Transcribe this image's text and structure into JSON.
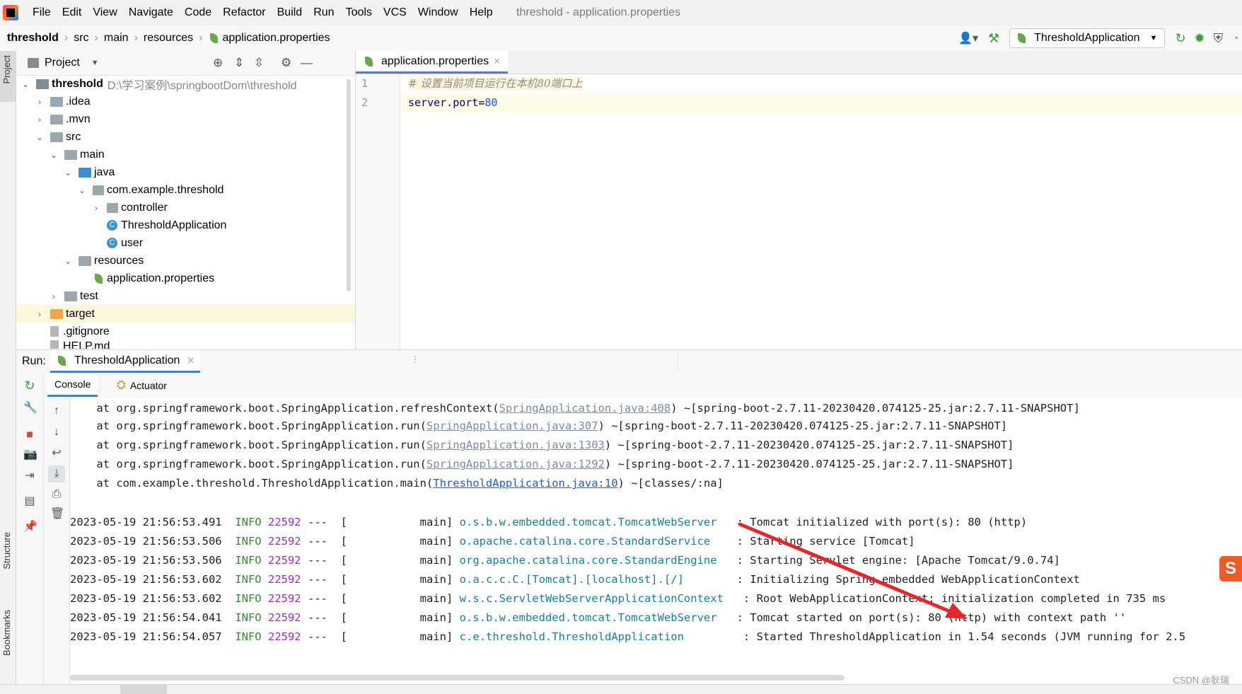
{
  "menubar": {
    "items": [
      "File",
      "Edit",
      "View",
      "Navigate",
      "Code",
      "Refactor",
      "Build",
      "Run",
      "Tools",
      "VCS",
      "Window",
      "Help"
    ],
    "title": "threshold - application.properties"
  },
  "navbar": {
    "crumbs": [
      "threshold",
      "src",
      "main",
      "resources",
      "application.properties"
    ],
    "run_config": "ThresholdApplication"
  },
  "left_stripe": {
    "project": "Project",
    "structure": "Structure",
    "bookmarks": "Bookmarks"
  },
  "project_panel": {
    "title": "Project",
    "root_name": "threshold",
    "root_path": "D:\\学习案例\\springbootDom\\threshold",
    "items": [
      {
        "label": ".idea"
      },
      {
        "label": ".mvn"
      },
      {
        "label": "src"
      },
      {
        "label": "main"
      },
      {
        "label": "java"
      },
      {
        "label": "com.example.threshold"
      },
      {
        "label": "controller"
      },
      {
        "label": "ThresholdApplication"
      },
      {
        "label": "user"
      },
      {
        "label": "resources"
      },
      {
        "label": "application.properties"
      },
      {
        "label": "test"
      },
      {
        "label": "target"
      },
      {
        "label": ".gitignore"
      },
      {
        "label": "HELP.md"
      }
    ]
  },
  "editor": {
    "tab": "application.properties",
    "line_numbers": [
      "1",
      "2"
    ],
    "line1": "# 设置当前项目运行在本机80端口上",
    "line2_key": "server.port",
    "line2_eq": "=",
    "line2_val": "80"
  },
  "run": {
    "label": "Run:",
    "tab": "ThresholdApplication",
    "subtabs": [
      "Console",
      "Actuator"
    ]
  },
  "console": {
    "stack": [
      {
        "pre": "    at org.springframework.boot.SpringApplication.refreshContext(",
        "link": "SpringApplication.java:408",
        "post": ") ~[spring-boot-2.7.11-20230420.074125-25.jar:2.7.11-SNAPSHOT]"
      },
      {
        "pre": "    at org.springframework.boot.SpringApplication.run(",
        "link": "SpringApplication.java:307",
        "post": ") ~[spring-boot-2.7.11-20230420.074125-25.jar:2.7.11-SNAPSHOT]"
      },
      {
        "pre": "    at org.springframework.boot.SpringApplication.run(",
        "link": "SpringApplication.java:1303",
        "post": ") ~[spring-boot-2.7.11-20230420.074125-25.jar:2.7.11-SNAPSHOT]"
      },
      {
        "pre": "    at org.springframework.boot.SpringApplication.run(",
        "link": "SpringApplication.java:1292",
        "post": ") ~[spring-boot-2.7.11-20230420.074125-25.jar:2.7.11-SNAPSHOT]"
      },
      {
        "pre": "    at com.example.threshold.ThresholdApplication.main(",
        "link": "ThresholdApplication.java:10",
        "post": ") ~[classes/:na]"
      }
    ],
    "logs": [
      {
        "ts": "2023-05-19 21:56:53.491",
        "level": "INFO",
        "pid": "22592",
        "thread": "---  [           main]",
        "logger": "o.s.b.w.embedded.tomcat.TomcatWebServer ",
        "msg": "  : Tomcat initialized with port(s): 80 (http)"
      },
      {
        "ts": "2023-05-19 21:56:53.506",
        "level": "INFO",
        "pid": "22592",
        "thread": "---  [           main]",
        "logger": "o.apache.catalina.core.StandardService  ",
        "msg": "  : Starting service [Tomcat]"
      },
      {
        "ts": "2023-05-19 21:56:53.506",
        "level": "INFO",
        "pid": "22592",
        "thread": "---  [           main]",
        "logger": "org.apache.catalina.core.StandardEngine ",
        "msg": "  : Starting Servlet engine: [Apache Tomcat/9.0.74]"
      },
      {
        "ts": "2023-05-19 21:56:53.602",
        "level": "INFO",
        "pid": "22592",
        "thread": "---  [           main]",
        "logger": "o.a.c.c.C.[Tomcat].[localhost].[/]      ",
        "msg": "  : Initializing Spring embedded WebApplicationContext"
      },
      {
        "ts": "2023-05-19 21:56:53.602",
        "level": "INFO",
        "pid": "22592",
        "thread": "---  [           main]",
        "logger": "w.s.c.ServletWebServerApplicationContext ",
        "msg": "  : Root WebApplicationContext: initialization completed in 735 ms"
      },
      {
        "ts": "2023-05-19 21:56:54.041",
        "level": "INFO",
        "pid": "22592",
        "thread": "---  [           main]",
        "logger": "o.s.b.w.embedded.tomcat.TomcatWebServer ",
        "msg": "  : Tomcat started on port(s): 80 (http) with context path ''"
      },
      {
        "ts": "2023-05-19 21:56:54.057",
        "level": "INFO",
        "pid": "22592",
        "thread": "---  [           main]",
        "logger": "c.e.threshold.ThresholdApplication       ",
        "msg": "  : Started ThresholdApplication in 1.54 seconds (JVM running for 2.5"
      }
    ]
  },
  "bottom": {
    "watermark": "CSDN @耿瑞"
  },
  "colors": {
    "accent": "#4083c9",
    "annotation_arrow": "#e5262a",
    "sogou": "#f05a24"
  }
}
